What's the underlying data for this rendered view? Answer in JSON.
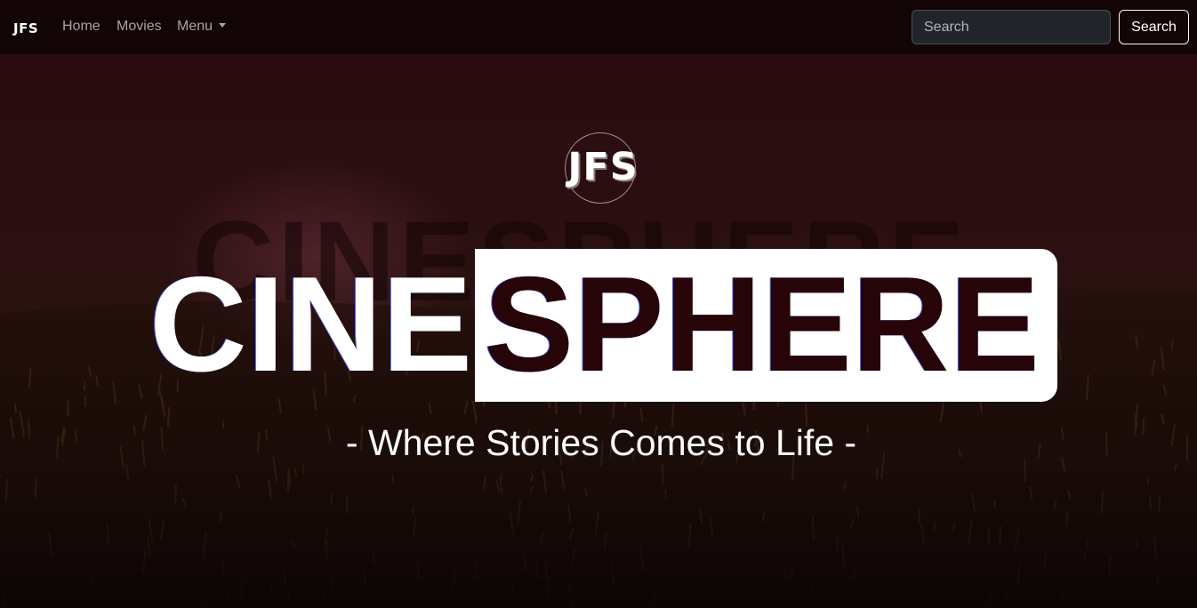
{
  "navbar": {
    "brand": "JFS",
    "links": {
      "home": "Home",
      "movies": "Movies",
      "menu": "Menu"
    },
    "search": {
      "placeholder": "Search",
      "button_label": "Search"
    }
  },
  "hero": {
    "logo_text": "JFS",
    "watermark_text": "CINESPHERE",
    "title_part1": "CINE",
    "title_part2": "SPHERE",
    "tagline": "- Where Stories Comes to Life -"
  },
  "colors": {
    "navbar_background": "#130406",
    "title_accent": "#260407",
    "title_box": "#ffffff"
  }
}
